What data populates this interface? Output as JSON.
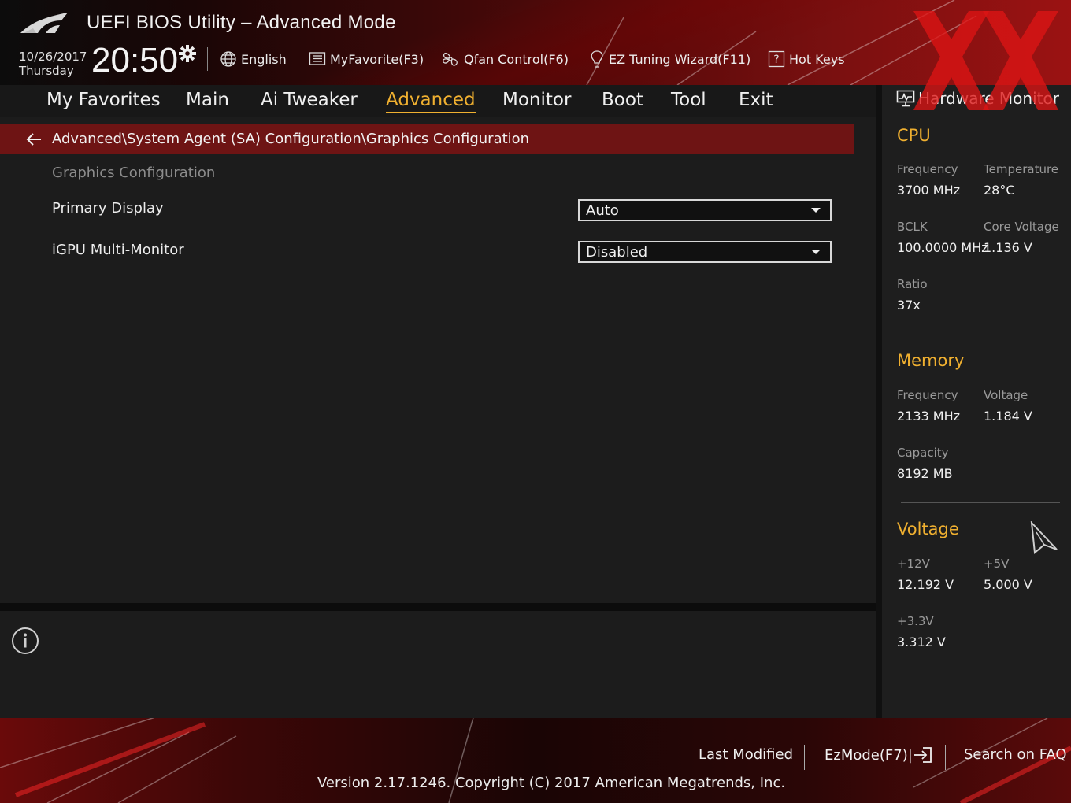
{
  "header": {
    "title": "UEFI BIOS Utility – Advanced Mode",
    "date": "10/26/2017",
    "weekday": "Thursday",
    "time": "20:50",
    "toolbar": [
      {
        "label": "English",
        "icon": "globe-icon"
      },
      {
        "label": "MyFavorite(F3)",
        "icon": "favorite-list-icon"
      },
      {
        "label": "Qfan Control(F6)",
        "icon": "fan-icon"
      },
      {
        "label": "EZ Tuning Wizard(F11)",
        "icon": "lightbulb-icon"
      },
      {
        "label": "Hot Keys",
        "icon": "help-key-icon"
      }
    ]
  },
  "nav": {
    "items": [
      "My Favorites",
      "Main",
      "Ai Tweaker",
      "Advanced",
      "Monitor",
      "Boot",
      "Tool",
      "Exit"
    ],
    "active": "Advanced"
  },
  "content": {
    "breadcrumb": "Advanced\\System Agent (SA) Configuration\\Graphics Configuration",
    "section_title": "Graphics Configuration",
    "settings": [
      {
        "label": "Primary Display",
        "value": "Auto"
      },
      {
        "label": "iGPU Multi-Monitor",
        "value": "Disabled"
      }
    ]
  },
  "hardware_monitor": {
    "title": "Hardware Monitor",
    "cpu": {
      "title": "CPU",
      "frequency_label": "Frequency",
      "frequency": "3700 MHz",
      "temperature_label": "Temperature",
      "temperature": "28°C",
      "bclk_label": "BCLK",
      "bclk": "100.0000 MHz",
      "core_voltage_label": "Core Voltage",
      "core_voltage": "1.136 V",
      "ratio_label": "Ratio",
      "ratio": "37x"
    },
    "memory": {
      "title": "Memory",
      "frequency_label": "Frequency",
      "frequency": "2133 MHz",
      "voltage_label": "Voltage",
      "voltage": "1.184 V",
      "capacity_label": "Capacity",
      "capacity": "8192 MB"
    },
    "voltage": {
      "title": "Voltage",
      "v12_label": "+12V",
      "v12": "12.192 V",
      "v5_label": "+5V",
      "v5": "5.000 V",
      "v33_label": "+3.3V",
      "v33": "3.312 V"
    }
  },
  "footer": {
    "last_modified": "Last Modified",
    "ezmode": "EzMode(F7)|",
    "search_faq": "Search on FAQ",
    "version": "Version 2.17.1246. Copyright (C) 2017 American Megatrends, Inc."
  },
  "colors": {
    "accent": "#f0b030",
    "breadcrumb_bg": "#6e1414",
    "panel_bg": "#1c1c1c"
  }
}
